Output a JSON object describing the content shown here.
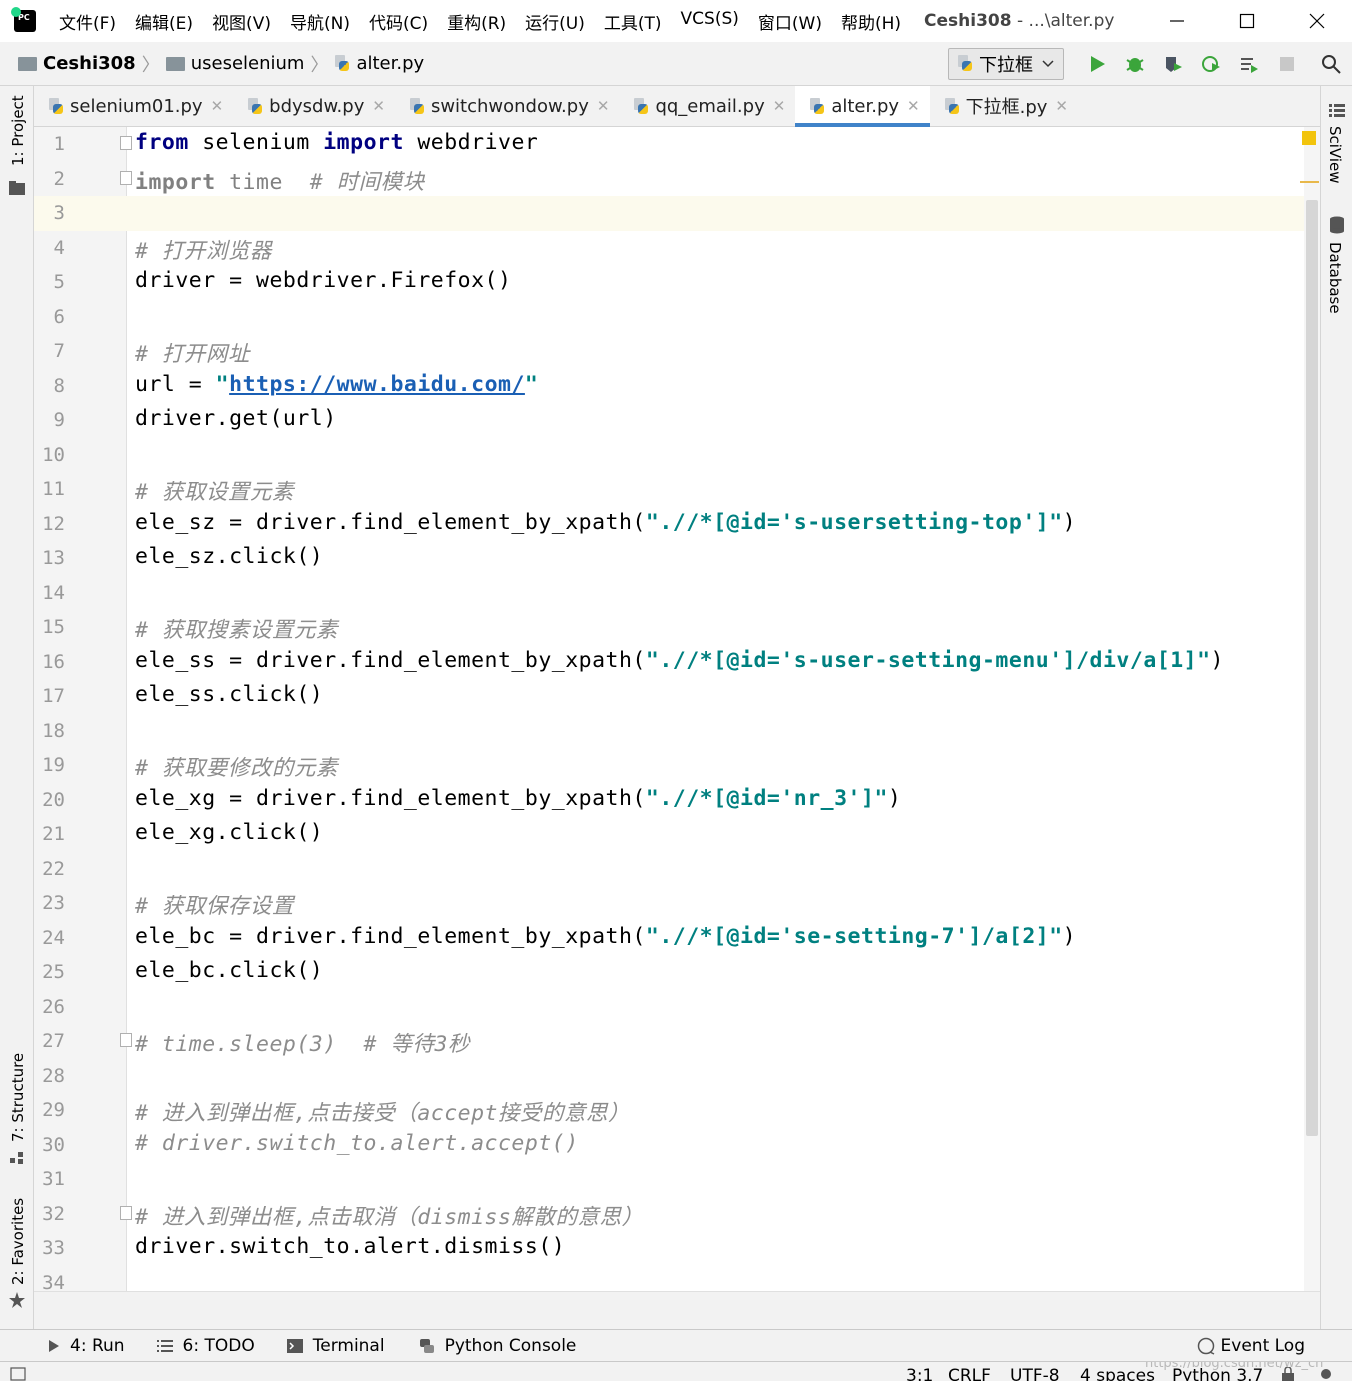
{
  "menubar": [
    "文件(F)",
    "编辑(E)",
    "视图(V)",
    "导航(N)",
    "代码(C)",
    "重构(R)",
    "运行(U)",
    "工具(T)",
    "VCS(S)",
    "窗口(W)",
    "帮助(H)"
  ],
  "window_title": {
    "project": "Ceshi308",
    "path": " - ...\\alter.py"
  },
  "breadcrumb": [
    "Ceshi308",
    "useselenium",
    "alter.py"
  ],
  "run_config": "下拉框",
  "tabs": [
    {
      "label": "selenium01.py",
      "active": false
    },
    {
      "label": "bdysdw.py",
      "active": false
    },
    {
      "label": "switchwondow.py",
      "active": false
    },
    {
      "label": "qq_email.py",
      "active": false
    },
    {
      "label": "alter.py",
      "active": true
    },
    {
      "label": "下拉框.py",
      "active": false
    }
  ],
  "left_tool_tabs": [
    "1: Project",
    "7: Structure",
    "2: Favorites"
  ],
  "right_tool_tabs": [
    "SciView",
    "Database"
  ],
  "code_lines": [
    "1",
    "2",
    "3",
    "4",
    "5",
    "6",
    "7",
    "8",
    "9",
    "10",
    "11",
    "12",
    "13",
    "14",
    "15",
    "16",
    "17",
    "18",
    "19",
    "20",
    "21",
    "22",
    "23",
    "24",
    "25",
    "26",
    "27",
    "28",
    "29",
    "30",
    "31",
    "32",
    "33",
    "34"
  ],
  "code": {
    "l1": [
      "from",
      " selenium ",
      "import",
      " webdriver"
    ],
    "l2": [
      "import",
      " time  ",
      "# 时间模块"
    ],
    "l4": "# 打开浏览器",
    "l5": "driver = webdriver.Firefox()",
    "l7": "# 打开网址",
    "l8": [
      "url = ",
      "\"",
      "https://www.baidu.com/",
      "\""
    ],
    "l9": "driver.get(url)",
    "l11": "# 获取设置元素",
    "l12": [
      "ele_sz = driver.find_element_by_xpath(",
      "\".//*[@id='s-usersetting-top']\"",
      ")"
    ],
    "l13": "ele_sz.click()",
    "l15": "# 获取搜素设置元素",
    "l16": [
      "ele_ss = driver.find_element_by_xpath(",
      "\".//*[@id='s-user-setting-menu']/div/a[1]\"",
      ")"
    ],
    "l17": "ele_ss.click()",
    "l19": "# 获取要修改的元素",
    "l20": [
      "ele_xg = driver.find_element_by_xpath(",
      "\".//*[@id='nr_3']\"",
      ")"
    ],
    "l21": "ele_xg.click()",
    "l23": "# 获取保存设置",
    "l24": [
      "ele_bc = driver.find_element_by_xpath(",
      "\".//*[@id='se-setting-7']/a[2]\"",
      ")"
    ],
    "l25": "ele_bc.click()",
    "l27": "# time.sleep(3)  # 等待3秒",
    "l29": "# 进入到弹出框,点击接受（accept接受的意思）",
    "l30": "# driver.switch_to.alert.accept()",
    "l32": "# 进入到弹出框,点击取消（dismiss解散的意思）",
    "l33": "driver.switch_to.alert.dismiss()"
  },
  "bottom_tabs": [
    {
      "icon": "run-icon",
      "label": "4: Run"
    },
    {
      "icon": "todo-icon",
      "label": "6: TODO"
    },
    {
      "icon": "terminal-icon",
      "label": "Terminal"
    },
    {
      "icon": "python-console-icon",
      "label": "Python Console"
    }
  ],
  "event_log": "Event Log",
  "status": {
    "position": "3:1",
    "line_sep": "CRLF",
    "encoding": "UTF-8",
    "indent": "4 spaces",
    "interpreter": "Python 3.7",
    "watermark": "https://blog.csdn.net/wz_ch"
  },
  "colors": {
    "keyword": "#000080",
    "comment": "#8c8c8c",
    "string": "#008080",
    "accent": "#4083c9",
    "current_line": "#fcfaed"
  }
}
